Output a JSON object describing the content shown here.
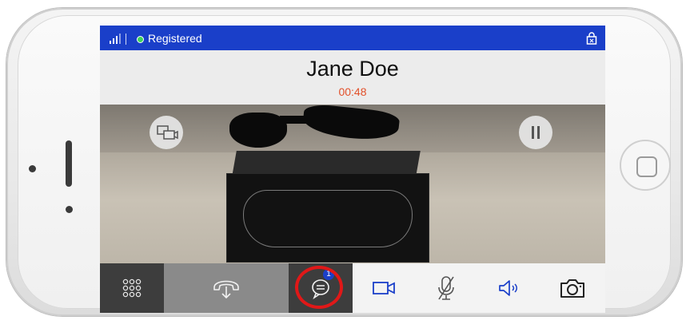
{
  "status_bar": {
    "status_text": "Registered",
    "status_color": "#3ed35a",
    "background": "#1a3fc9",
    "icons": [
      "signal-icon",
      "lock-icon"
    ]
  },
  "call": {
    "caller_name": "Jane Doe",
    "timer": "00:48",
    "timer_color": "#e2502a"
  },
  "video_overlay": {
    "left_button_icon": "switch-camera-icon",
    "right_button_icon": "pause-icon"
  },
  "toolbar": {
    "items": [
      {
        "name": "dialpad",
        "icon": "dialpad-icon"
      },
      {
        "name": "transfer",
        "icon": "transfer-call-icon"
      },
      {
        "name": "chat",
        "icon": "chat-icon",
        "badge": "1"
      },
      {
        "name": "video",
        "icon": "video-camera-icon"
      },
      {
        "name": "mute",
        "icon": "mute-microphone-icon"
      },
      {
        "name": "speaker",
        "icon": "speaker-icon"
      },
      {
        "name": "snapshot",
        "icon": "camera-icon"
      }
    ],
    "accent": "#1a3fc9",
    "highlight_ring_color": "#e01818"
  }
}
